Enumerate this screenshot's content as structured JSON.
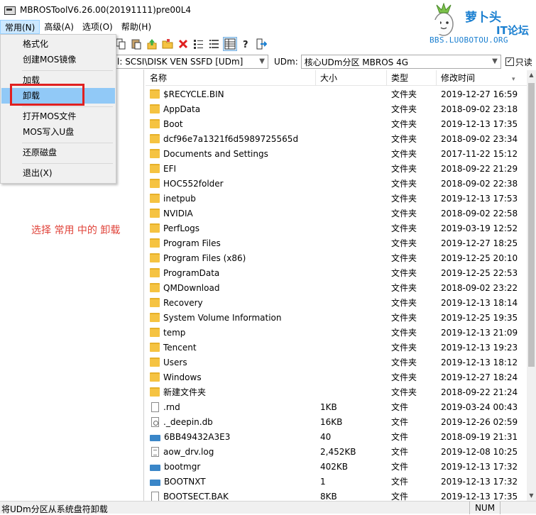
{
  "window": {
    "title": "MBROSToolV6.26.00(20191111)pre00L4"
  },
  "logo": {
    "brand": "萝卜头",
    "brand_sub": "IT论坛",
    "url": "BBS.LUOBOTOU.ORG"
  },
  "menubar": [
    {
      "label": "常用(N)",
      "active": true
    },
    {
      "label": "高级(A)"
    },
    {
      "label": "选项(O)"
    },
    {
      "label": "帮助(H)"
    }
  ],
  "dropdown": {
    "items": [
      {
        "label": "格式化"
      },
      {
        "label": "创建MOS镜像"
      },
      {
        "label": "加载"
      },
      {
        "label": "卸载",
        "highlighted": true
      },
      {
        "label": "打开MOS文件"
      },
      {
        "label": "MOS写入U盘"
      },
      {
        "label": "还原磁盘"
      },
      {
        "label": "退出(X)"
      }
    ]
  },
  "toolbar": {
    "icons": [
      "copy-icon",
      "paste-icon",
      "upload-icon",
      "folder-open-icon",
      "delete-icon",
      "list-view-icon",
      "detail-view-icon",
      "grid-view-icon",
      "help-icon",
      "exit-icon"
    ]
  },
  "diskbar": {
    "disk_value": "l: SCSI\\DISK  VEN SSFD [UDm]",
    "udm_label": "UDm:",
    "partition_value": "核心UDm分区  MBROS 4G",
    "readonly_label": "只读",
    "readonly_checked": true
  },
  "annotation": "选择 常用 中的 卸载",
  "table": {
    "headers": {
      "name": "名称",
      "size": "大小",
      "type": "类型",
      "date": "修改时间"
    },
    "rows": [
      {
        "icon": "folder",
        "name": "$RECYCLE.BIN",
        "size": "",
        "type": "文件夹",
        "date": "2019-12-27 16:59"
      },
      {
        "icon": "folder",
        "name": "AppData",
        "size": "",
        "type": "文件夹",
        "date": "2018-09-02 23:18"
      },
      {
        "icon": "folder",
        "name": "Boot",
        "size": "",
        "type": "文件夹",
        "date": "2019-12-13 17:35"
      },
      {
        "icon": "folder",
        "name": "dcf96e7a1321f6d5989725565d",
        "size": "",
        "type": "文件夹",
        "date": "2018-09-02 23:34"
      },
      {
        "icon": "folder",
        "name": "Documents and Settings",
        "size": "",
        "type": "文件夹",
        "date": "2017-11-22 15:12"
      },
      {
        "icon": "folder",
        "name": "EFI",
        "size": "",
        "type": "文件夹",
        "date": "2018-09-22 21:29"
      },
      {
        "icon": "folder",
        "name": "HOC552folder",
        "size": "",
        "type": "文件夹",
        "date": "2018-09-02 22:38"
      },
      {
        "icon": "folder",
        "name": "inetpub",
        "size": "",
        "type": "文件夹",
        "date": "2019-12-13 17:53"
      },
      {
        "icon": "folder",
        "name": "NVIDIA",
        "size": "",
        "type": "文件夹",
        "date": "2018-09-02 22:58"
      },
      {
        "icon": "folder",
        "name": "PerfLogs",
        "size": "",
        "type": "文件夹",
        "date": "2019-03-19 12:52"
      },
      {
        "icon": "folder",
        "name": "Program Files",
        "size": "",
        "type": "文件夹",
        "date": "2019-12-27 18:25"
      },
      {
        "icon": "folder",
        "name": "Program Files (x86)",
        "size": "",
        "type": "文件夹",
        "date": "2019-12-25 20:10"
      },
      {
        "icon": "folder",
        "name": "ProgramData",
        "size": "",
        "type": "文件夹",
        "date": "2019-12-25 22:53"
      },
      {
        "icon": "folder",
        "name": "QMDownload",
        "size": "",
        "type": "文件夹",
        "date": "2018-09-02 23:22"
      },
      {
        "icon": "folder",
        "name": "Recovery",
        "size": "",
        "type": "文件夹",
        "date": "2019-12-13 18:14"
      },
      {
        "icon": "folder",
        "name": "System Volume Information",
        "size": "",
        "type": "文件夹",
        "date": "2019-12-25 19:35"
      },
      {
        "icon": "folder",
        "name": "temp",
        "size": "",
        "type": "文件夹",
        "date": "2019-12-13 21:09"
      },
      {
        "icon": "folder",
        "name": "Tencent",
        "size": "",
        "type": "文件夹",
        "date": "2019-12-13 19:23"
      },
      {
        "icon": "folder",
        "name": "Users",
        "size": "",
        "type": "文件夹",
        "date": "2019-12-13 18:12"
      },
      {
        "icon": "folder",
        "name": "Windows",
        "size": "",
        "type": "文件夹",
        "date": "2019-12-27 18:24"
      },
      {
        "icon": "folder",
        "name": "新建文件夹",
        "size": "",
        "type": "文件夹",
        "date": "2018-09-22 21:24"
      },
      {
        "icon": "file",
        "name": ".rnd",
        "size": "1KB",
        "type": "文件",
        "date": "2019-03-24 00:43"
      },
      {
        "icon": "gear",
        "name": "._deepin.db",
        "size": "16KB",
        "type": "文件",
        "date": "2019-12-26 02:59"
      },
      {
        "icon": "sys",
        "name": "6BB49432A3E3",
        "size": "40",
        "type": "文件",
        "date": "2018-09-19 21:31"
      },
      {
        "icon": "lines",
        "name": "aow_drv.log",
        "size": "2,452KB",
        "type": "文件",
        "date": "2019-12-08 10:25"
      },
      {
        "icon": "sys",
        "name": "bootmgr",
        "size": "402KB",
        "type": "文件",
        "date": "2019-12-13 17:32"
      },
      {
        "icon": "sys",
        "name": "BOOTNXT",
        "size": "1",
        "type": "文件",
        "date": "2019-12-13 17:32"
      },
      {
        "icon": "file",
        "name": "BOOTSECT.BAK",
        "size": "8KB",
        "type": "文件",
        "date": "2019-12-13 17:35"
      }
    ]
  },
  "statusbar": {
    "text": "将UDm分区从系统盘符卸载",
    "num": "NUM"
  },
  "colors": {
    "menu_highlight": "#91c9f7",
    "annotation": "#e0433a",
    "folder": "#f5c342",
    "redbox": "#e02020"
  }
}
